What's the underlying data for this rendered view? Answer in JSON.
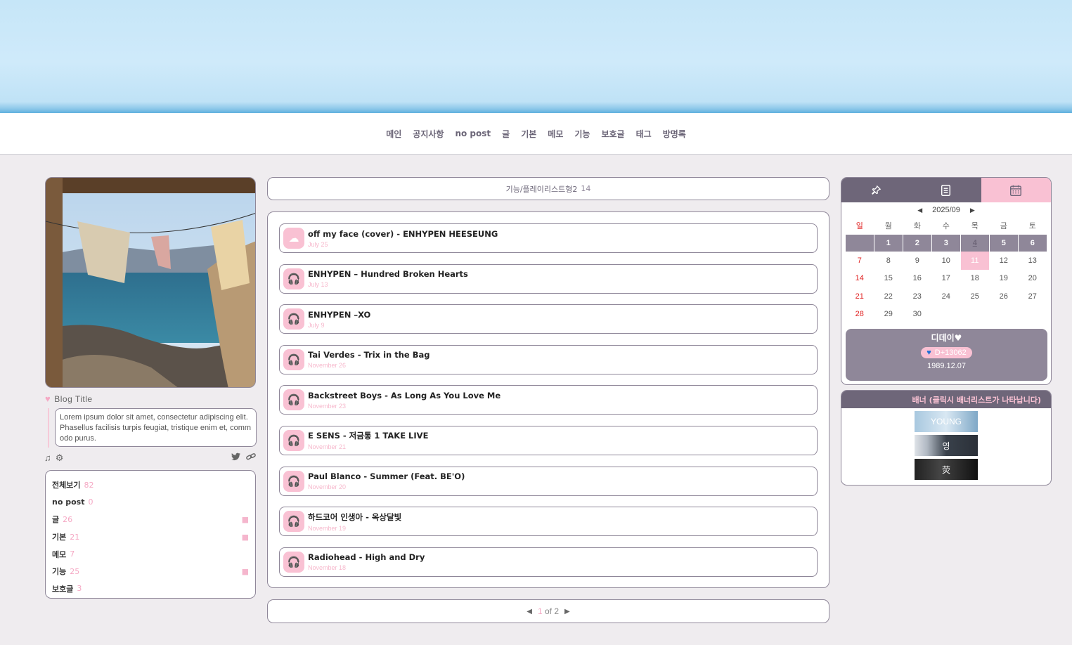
{
  "nav": [
    "메인",
    "공지사항",
    "no post",
    "글",
    "기본",
    "메모",
    "기능",
    "보호글",
    "태그",
    "방명록"
  ],
  "profile": {
    "blog_title": "Blog Title",
    "description": "Lorem ipsum dolor sit amet, consectetur adipiscing elit.Phasellus facilisis turpis feugiat, tristique enim et, commodo purus."
  },
  "categories": [
    {
      "name": "전체보기",
      "count": "82",
      "folder": false
    },
    {
      "name": "no post",
      "count": "0",
      "folder": false
    },
    {
      "name": "글",
      "count": "26",
      "folder": true
    },
    {
      "name": "기본",
      "count": "21",
      "folder": true
    },
    {
      "name": "메모",
      "count": "7",
      "folder": false
    },
    {
      "name": "기능",
      "count": "25",
      "folder": true
    },
    {
      "name": "보호글",
      "count": "3",
      "folder": false
    }
  ],
  "list_header": {
    "title": "기능/플레이리스트형2",
    "count": "14"
  },
  "posts": [
    {
      "title": "off my face (cover) - ENHYPEN HEESEUNG",
      "date": "July 25",
      "icon": "soundcloud-icon"
    },
    {
      "title": "ENHYPEN – Hundred Broken Hearts",
      "date": "July 13",
      "icon": "headphones-icon"
    },
    {
      "title": "ENHYPEN –XO",
      "date": "July 9",
      "icon": "headphones-icon"
    },
    {
      "title": "Tai Verdes - Trix in the Bag",
      "date": "November 26",
      "icon": "headphones-icon"
    },
    {
      "title": "Backstreet Boys - As Long As You Love Me",
      "date": "November 23",
      "icon": "headphones-icon"
    },
    {
      "title": "E SENS - 저금통 1 TAKE LIVE",
      "date": "November 21",
      "icon": "headphones-icon"
    },
    {
      "title": "Paul Blanco - Summer (Feat. BE'O)",
      "date": "November 20",
      "icon": "headphones-icon"
    },
    {
      "title": "하드코어 인생아 - 옥상달빛",
      "date": "November 19",
      "icon": "headphones-icon"
    },
    {
      "title": "Radiohead - High and Dry",
      "date": "November 18",
      "icon": "headphones-icon"
    }
  ],
  "pager": {
    "current": "1",
    "of_text": "of 2"
  },
  "calendar": {
    "month": "2025/09",
    "day_names": [
      "일",
      "월",
      "화",
      "수",
      "목",
      "금",
      "토"
    ],
    "weeks": [
      [
        "",
        "1",
        "2",
        "3",
        "4",
        "5",
        "6"
      ],
      [
        "7",
        "8",
        "9",
        "10",
        "11",
        "12",
        "13"
      ],
      [
        "14",
        "15",
        "16",
        "17",
        "18",
        "19",
        "20"
      ],
      [
        "21",
        "22",
        "23",
        "24",
        "25",
        "26",
        "27"
      ],
      [
        "28",
        "29",
        "30",
        "",
        "",
        "",
        ""
      ]
    ],
    "today": "11"
  },
  "dday": {
    "label": "디데이",
    "count": "D+13062",
    "date": "1989.12.07"
  },
  "banner": {
    "header": "배너 (클릭시 배너리스트가 나타납니다)",
    "items": [
      "YOUNG",
      "영",
      "荧"
    ]
  },
  "colors": {
    "accent_pink": "#f9c1d3",
    "frame": "#8f8799",
    "dark": "#6e6679"
  }
}
